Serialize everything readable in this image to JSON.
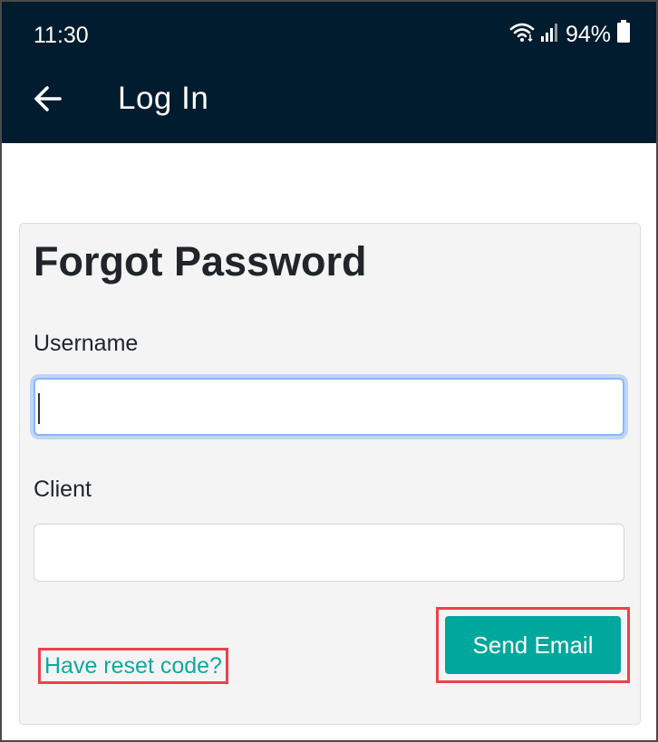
{
  "status_bar": {
    "time": "11:30",
    "battery": "94%",
    "icons": [
      "wifi-icon",
      "signal-icon",
      "battery-icon"
    ]
  },
  "app_bar": {
    "title": "Log In",
    "back_icon": "arrow-left-icon"
  },
  "form": {
    "heading": "Forgot Password",
    "username": {
      "label": "Username",
      "value": "",
      "placeholder": ""
    },
    "client": {
      "label": "Client",
      "value": "",
      "placeholder": ""
    },
    "reset_link": "Have reset code?",
    "submit_label": "Send Email"
  },
  "colors": {
    "app_bar_bg": "#001c2e",
    "accent": "#00a79d",
    "link": "#12a8a0",
    "highlight": "#e8434a"
  }
}
